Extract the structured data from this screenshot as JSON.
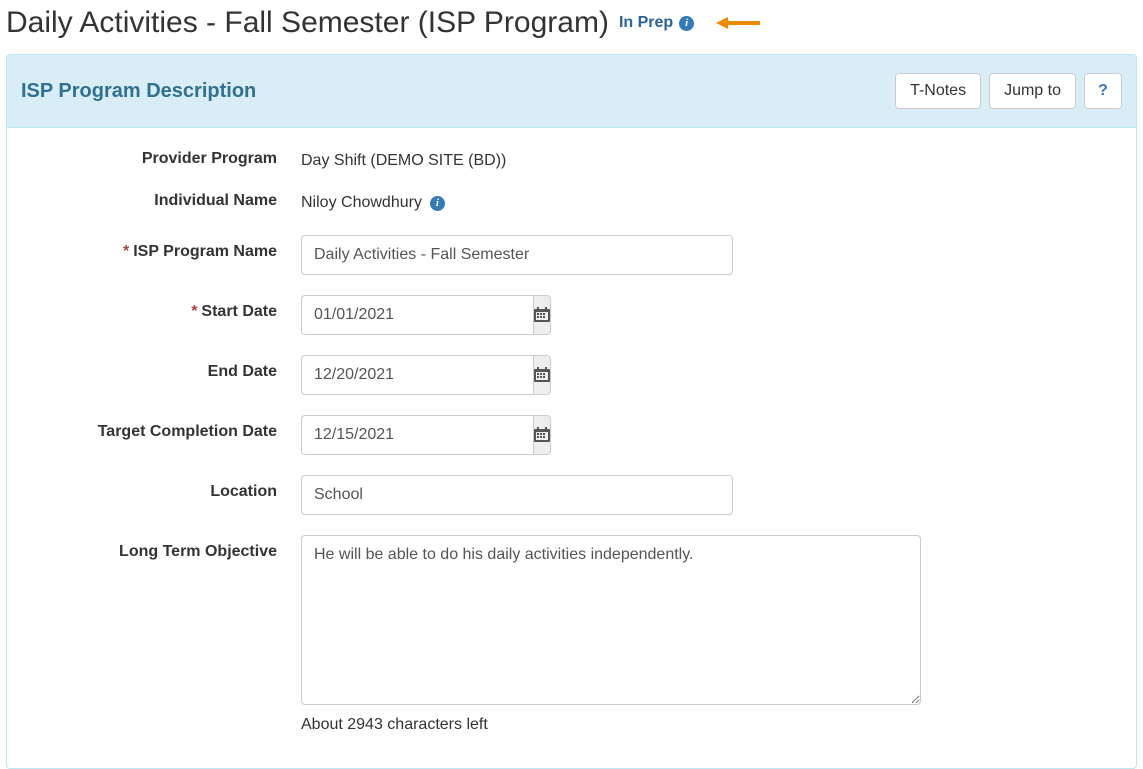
{
  "page": {
    "title": "Daily Activities - Fall Semester (ISP Program)",
    "status": "In Prep"
  },
  "panel": {
    "title": "ISP Program Description",
    "actions": {
      "tnotes": "T-Notes",
      "jumpto": "Jump to",
      "help": "?"
    }
  },
  "form": {
    "labels": {
      "providerProgram": "Provider Program",
      "individualName": "Individual Name",
      "ispProgramName": "ISP Program Name",
      "startDate": "Start Date",
      "endDate": "End Date",
      "targetCompletionDate": "Target Completion Date",
      "location": "Location",
      "longTermObjective": "Long Term Objective"
    },
    "values": {
      "providerProgram": "Day Shift (DEMO SITE (BD))",
      "individualName": "Niloy Chowdhury",
      "ispProgramName": "Daily Activities - Fall Semester",
      "startDate": "01/01/2021",
      "endDate": "12/20/2021",
      "targetCompletionDate": "12/15/2021",
      "location": "School",
      "longTermObjective": "He will be able to do his daily activities independently."
    },
    "charLeft": "About 2943 characters left",
    "required": {
      "ispProgramName": true,
      "startDate": true
    }
  },
  "colors": {
    "panelHeadingBg": "#d9edf7",
    "panelHeadingText": "#31708f",
    "link": "#337ab7",
    "annotationArrow": "#ed8b00"
  },
  "icons": {
    "info": "info-circle-icon",
    "calendar": "calendar-icon",
    "arrow": "arrow-left-icon"
  }
}
